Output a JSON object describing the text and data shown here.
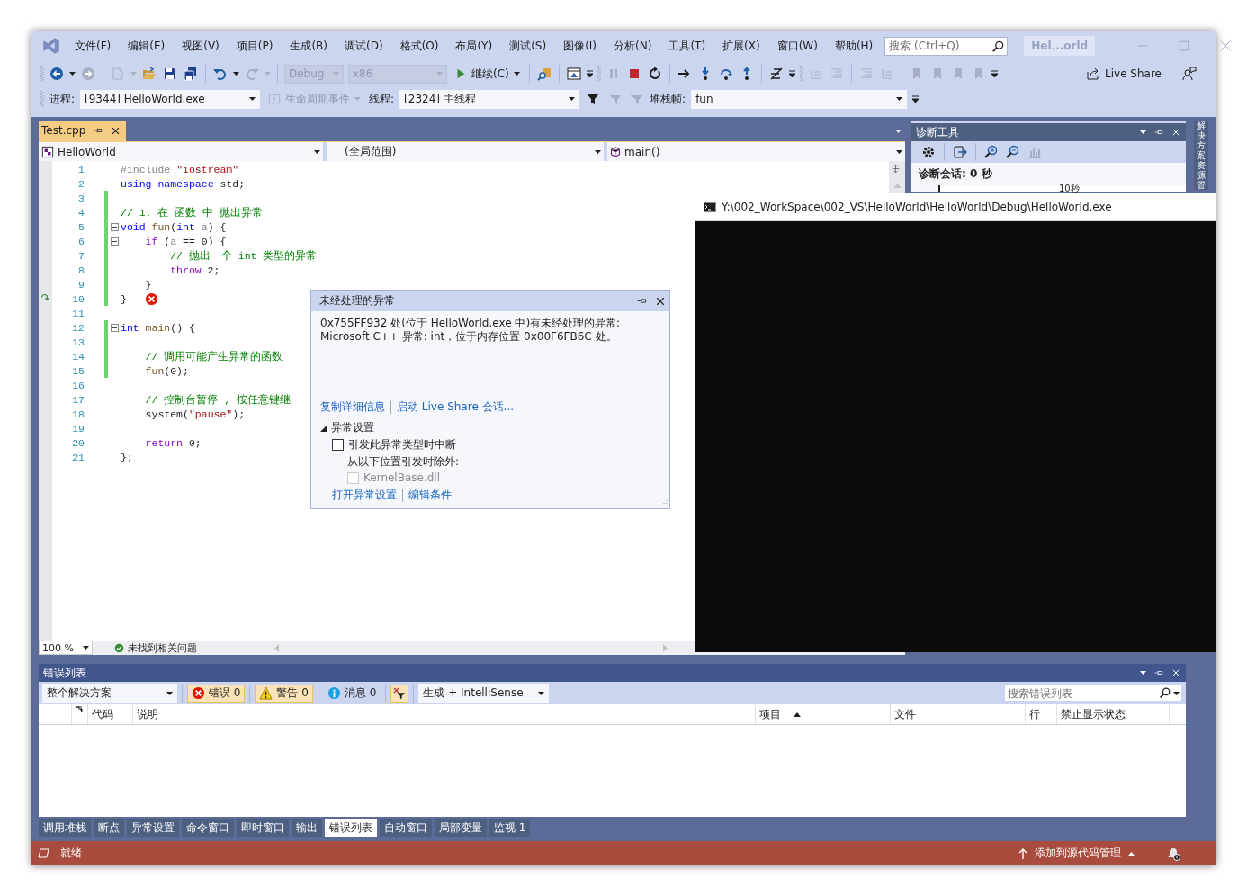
{
  "window": {
    "title": "Hel...orld"
  },
  "menu": [
    "文件(F)",
    "编辑(E)",
    "视图(V)",
    "项目(P)",
    "生成(B)",
    "调试(D)",
    "格式(O)",
    "布局(Y)",
    "测试(S)",
    "图像(I)",
    "分析(N)",
    "工具(T)",
    "扩展(X)",
    "窗口(W)",
    "帮助(H)"
  ],
  "search": {
    "placeholder": "搜索 (Ctrl+Q)"
  },
  "toolbar": {
    "configuration": {
      "value": "Debug",
      "disabled": true
    },
    "platform": {
      "value": "x86",
      "disabled": true
    },
    "continue_button": "继续(C)",
    "live_share": "Live Share"
  },
  "debug_location": {
    "process_label": "进程:",
    "process": "[9344] HelloWorld.exe",
    "lifecycle_events": {
      "label": "生命周期事件",
      "disabled": true
    },
    "thread_label": "线程:",
    "thread": "[2324] 主线程",
    "stack_frame_label": "堆栈帧:",
    "stack_frame": "fun"
  },
  "editor": {
    "tabs": [
      {
        "label": "Test.cpp",
        "selected": true
      }
    ],
    "nav": {
      "project": "HelloWorld",
      "scope": "(全局范围)",
      "member": "main()"
    },
    "lines": [
      {
        "number": "1",
        "changed": false,
        "fold": false,
        "tokens": [
          {
            "kind": "preproc",
            "text": "#include "
          },
          {
            "kind": "string",
            "text": "\"iostream\""
          }
        ]
      },
      {
        "number": "2",
        "changed": false,
        "fold": false,
        "tokens": [
          {
            "kind": "keyword",
            "text": "using"
          },
          {
            "kind": "keyword",
            "text": " namespace"
          },
          {
            "kind": "plain",
            "text": " std;"
          }
        ]
      },
      {
        "number": "3",
        "changed": true,
        "fold": false
      },
      {
        "number": "4",
        "changed": true,
        "fold": false,
        "tokens": [
          {
            "kind": "comment",
            "text": "// 1. 在 函数 中 抛出异常"
          }
        ]
      },
      {
        "number": "5",
        "changed": true,
        "fold": true,
        "tokens": [
          {
            "kind": "keyword",
            "text": "void"
          },
          {
            "kind": "function",
            "text": " fun"
          },
          {
            "kind": "plain",
            "text": "("
          },
          {
            "kind": "keyword",
            "text": "int"
          },
          {
            "kind": "param",
            "text": " a"
          },
          {
            "kind": "plain",
            "text": ") {"
          }
        ]
      },
      {
        "number": "6",
        "changed": true,
        "fold": true,
        "tokens": [
          {
            "kind": "control",
            "text": "    if"
          },
          {
            "kind": "plain",
            "text": " ("
          },
          {
            "kind": "param",
            "text": "a"
          },
          {
            "kind": "plain",
            "text": " == 0) {"
          }
        ]
      },
      {
        "number": "7",
        "changed": true,
        "fold": false,
        "tokens": [
          {
            "kind": "comment",
            "text": "        // 抛出一个 int 类型的异常"
          }
        ]
      },
      {
        "number": "8",
        "changed": true,
        "fold": false,
        "tokens": [
          {
            "kind": "control",
            "text": "        throw"
          },
          {
            "kind": "plain",
            "text": " 2;"
          }
        ]
      },
      {
        "number": "9",
        "changed": true,
        "fold": false,
        "tokens": [
          {
            "kind": "plain",
            "text": "    }"
          }
        ]
      },
      {
        "number": "10",
        "changed": true,
        "fold": false,
        "current": true,
        "error": true,
        "tokens": [
          {
            "kind": "plain",
            "text": "}"
          }
        ]
      },
      {
        "number": "11",
        "changed": false,
        "fold": false
      },
      {
        "number": "12",
        "changed": true,
        "fold": true,
        "tokens": [
          {
            "kind": "keyword",
            "text": "int"
          },
          {
            "kind": "function",
            "text": " main"
          },
          {
            "kind": "plain",
            "text": "() {"
          }
        ]
      },
      {
        "number": "13",
        "changed": true,
        "fold": false
      },
      {
        "number": "14",
        "changed": true,
        "fold": false,
        "tokens": [
          {
            "kind": "comment",
            "text": "    // 调用可能产生异常的函数"
          }
        ]
      },
      {
        "number": "15",
        "changed": true,
        "fold": false,
        "tokens": [
          {
            "kind": "function",
            "text": "    fun"
          },
          {
            "kind": "plain",
            "text": "(0);"
          }
        ]
      },
      {
        "number": "16",
        "changed": false,
        "fold": false
      },
      {
        "number": "17",
        "changed": false,
        "fold": false,
        "tokens": [
          {
            "kind": "comment",
            "text": "    // 控制台暂停 , 按任意键继"
          }
        ]
      },
      {
        "number": "18",
        "changed": false,
        "fold": false,
        "tokens": [
          {
            "kind": "plain",
            "text": "    system("
          },
          {
            "kind": "string",
            "text": "\"pause\""
          },
          {
            "kind": "plain",
            "text": ");"
          }
        ]
      },
      {
        "number": "19",
        "changed": false,
        "fold": false
      },
      {
        "number": "20",
        "changed": false,
        "fold": false,
        "tokens": [
          {
            "kind": "control",
            "text": "    return"
          },
          {
            "kind": "plain",
            "text": " 0;"
          }
        ]
      },
      {
        "number": "21",
        "changed": false,
        "fold": false,
        "tokens": [
          {
            "kind": "plain",
            "text": "};"
          }
        ]
      }
    ],
    "zoom": "100 %",
    "issues": "未找到相关问题"
  },
  "exception_popup": {
    "title": "未经处理的异常",
    "message_lines": [
      "0x755FF932 处(位于 HelloWorld.exe 中)有未经处理的异常:",
      "Microsoft C++ 异常: int，位于内存位置 0x00F6FB6C 处。"
    ],
    "links": [
      "复制详细信息",
      "启动 Live Share 会话..."
    ],
    "settings": {
      "title": "异常设置",
      "expanded": true,
      "break_option": {
        "label": "引发此异常类型时中断",
        "checked": false
      },
      "except_label": "从以下位置引发时除外:",
      "modules": [
        {
          "label": "KernelBase.dll",
          "checked": false,
          "disabled": true
        }
      ],
      "links": [
        "打开异常设置",
        "编辑条件"
      ]
    }
  },
  "diagnostics": {
    "title": "诊断工具",
    "session": "诊断会话: 0 秒",
    "timeline_label": "10秒"
  },
  "side_tabs": [
    {
      "label": "解决方案资源管"
    }
  ],
  "console": {
    "title": "Y:\\002_WorkSpace\\002_VS\\HelloWorld\\HelloWorld\\Debug\\HelloWorld.exe"
  },
  "error_list": {
    "title": "错误列表",
    "scope": "整个解决方案",
    "filters": [
      {
        "kind": "error",
        "label": "错误 0",
        "selected": true
      },
      {
        "kind": "warning",
        "label": "警告 0",
        "selected": true
      },
      {
        "kind": "message",
        "label": "消息 0",
        "selected": false
      }
    ],
    "filter_toggle": {
      "selected": true
    },
    "source": "生成 + IntelliSense",
    "search": {
      "placeholder": "搜索错误列表"
    },
    "columns": [
      {
        "label": "代码",
        "sorted": false
      },
      {
        "label": "说明",
        "sorted": false
      },
      {
        "label": "项目",
        "sorted": true
      },
      {
        "label": "文件",
        "sorted": false
      },
      {
        "label": "行",
        "sorted": false
      },
      {
        "label": "禁止显示状态",
        "sorted": false
      }
    ]
  },
  "bottom_tabs": [
    {
      "label": "调用堆栈",
      "selected": false
    },
    {
      "label": "断点",
      "selected": false
    },
    {
      "label": "异常设置",
      "selected": false
    },
    {
      "label": "命令窗口",
      "selected": false
    },
    {
      "label": "即时窗口",
      "selected": false
    },
    {
      "label": "输出",
      "selected": false
    },
    {
      "label": "错误列表",
      "selected": true
    },
    {
      "label": "自动窗口",
      "selected": false
    },
    {
      "label": "局部变量",
      "selected": false
    },
    {
      "label": "监视 1",
      "selected": false
    }
  ],
  "status_bar": {
    "text": "就绪",
    "source_control": "添加到源代码管理"
  }
}
